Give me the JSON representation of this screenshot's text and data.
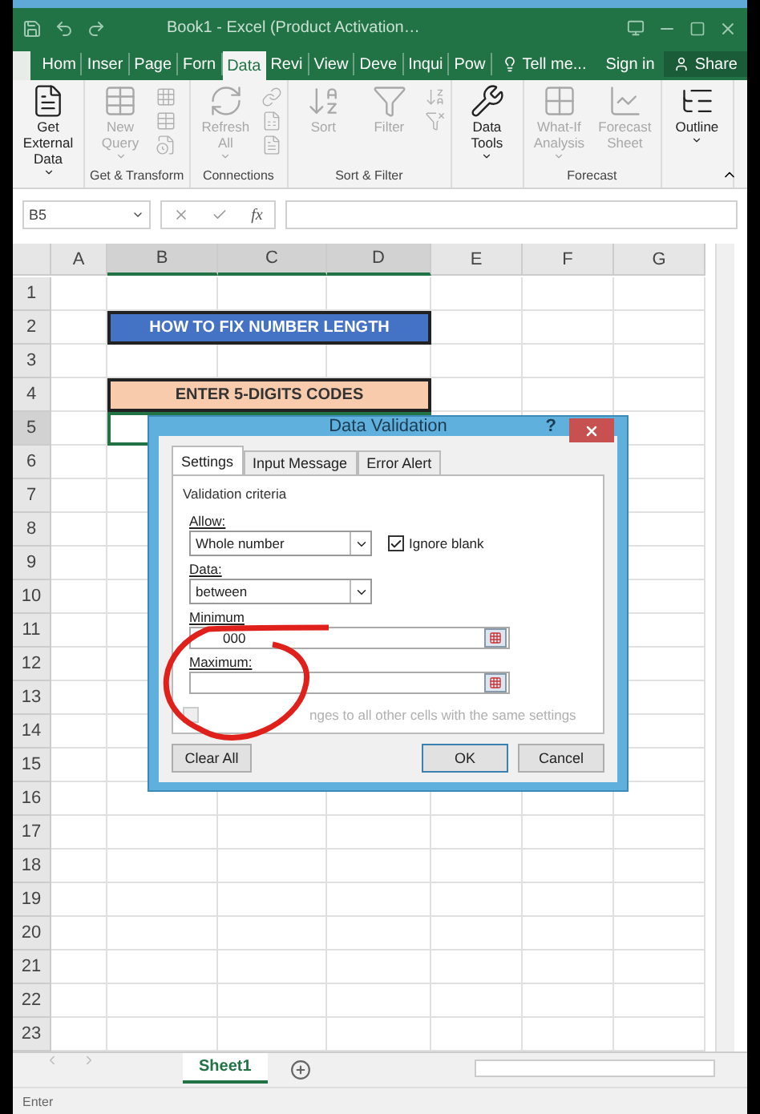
{
  "title_bar": {
    "title": "Book1 - Excel (Product Activation…"
  },
  "ribbon_tabs": [
    {
      "label": "Hom",
      "selected": false
    },
    {
      "label": "Inser",
      "selected": false
    },
    {
      "label": "Page",
      "selected": false
    },
    {
      "label": "Forn",
      "selected": false
    },
    {
      "label": "Data",
      "selected": true
    },
    {
      "label": "Revi",
      "selected": false
    },
    {
      "label": "View",
      "selected": false
    },
    {
      "label": "Deve",
      "selected": false
    },
    {
      "label": "Inqui",
      "selected": false
    },
    {
      "label": "Pow",
      "selected": false
    }
  ],
  "tell_me": "Tell me...",
  "sign_in": "Sign in",
  "share": "Share",
  "ribbon_groups": [
    {
      "commands": [
        {
          "label": "Get External Data",
          "dropdown": true,
          "disabled": false
        }
      ]
    },
    {
      "label": "Get & Transform",
      "commands": [
        {
          "label": "New Query",
          "dropdown": true,
          "disabled": true
        }
      ],
      "small_buttons": [
        {
          "disabled": true
        },
        {
          "disabled": true
        },
        {
          "disabled": true
        }
      ]
    },
    {
      "label": "Connections",
      "commands": [
        {
          "label": "Refresh All",
          "dropdown": true,
          "disabled": true
        }
      ],
      "small_buttons": [
        {
          "disabled": true
        },
        {
          "disabled": true
        },
        {
          "disabled": true
        }
      ]
    },
    {
      "label": "Sort & Filter",
      "commands": [
        {
          "label": "Sort",
          "dropdown": false,
          "disabled": true
        },
        {
          "label": "Filter",
          "dropdown": false,
          "disabled": true
        }
      ],
      "small_buttons": [
        {
          "disabled": true
        },
        {
          "disabled": true
        }
      ]
    },
    {
      "commands": [
        {
          "label": "Data Tools",
          "dropdown": true,
          "disabled": false
        }
      ]
    },
    {
      "label": "Forecast",
      "commands": [
        {
          "label": "What-If Analysis",
          "dropdown": true,
          "disabled": true
        },
        {
          "label": "Forecast Sheet",
          "dropdown": false,
          "disabled": true
        }
      ]
    },
    {
      "commands": [
        {
          "label": "Outline",
          "dropdown": true,
          "disabled": false
        }
      ]
    }
  ],
  "formula_bar": {
    "name_box": "B5",
    "fx": "fx"
  },
  "columns": [
    {
      "label": "A",
      "selected": false
    },
    {
      "label": "B",
      "selected": true
    },
    {
      "label": "C",
      "selected": true
    },
    {
      "label": "D",
      "selected": true
    },
    {
      "label": "E",
      "selected": false
    },
    {
      "label": "F",
      "selected": false
    },
    {
      "label": "G",
      "selected": false
    }
  ],
  "rows": [
    {
      "label": "1",
      "selected": false
    },
    {
      "label": "2",
      "selected": false,
      "merged_cell": {
        "kind": "title",
        "text": "HOW TO FIX NUMBER LENGTH"
      }
    },
    {
      "label": "3",
      "selected": false
    },
    {
      "label": "4",
      "selected": false,
      "merged_cell": {
        "kind": "header",
        "text": "ENTER 5-DIGITS CODES"
      }
    },
    {
      "label": "5",
      "selected": true,
      "merged_cell": {
        "kind": "active"
      }
    },
    {
      "label": "6",
      "selected": false
    },
    {
      "label": "7",
      "selected": false
    },
    {
      "label": "8",
      "selected": false
    },
    {
      "label": "9",
      "selected": false
    },
    {
      "label": "10",
      "selected": false
    },
    {
      "label": "11",
      "selected": false
    },
    {
      "label": "12",
      "selected": false
    },
    {
      "label": "13",
      "selected": false
    },
    {
      "label": "14",
      "selected": false
    },
    {
      "label": "15",
      "selected": false
    },
    {
      "label": "16",
      "selected": false
    },
    {
      "label": "17",
      "selected": false
    },
    {
      "label": "18",
      "selected": false
    },
    {
      "label": "19",
      "selected": false
    },
    {
      "label": "20",
      "selected": false
    },
    {
      "label": "21",
      "selected": false
    },
    {
      "label": "22",
      "selected": false
    },
    {
      "label": "23",
      "selected": false
    }
  ],
  "dialog": {
    "title": "Data Validation",
    "help": "?",
    "tabs": [
      {
        "label": "Settings",
        "selected": true
      },
      {
        "label": "Input Message",
        "selected": false
      },
      {
        "label": "Error Alert",
        "selected": false
      }
    ],
    "section": "Validation criteria",
    "allow": {
      "label": "Allow:",
      "value": "Whole number"
    },
    "ignore_blank": {
      "label": "Ignore blank",
      "checked": true
    },
    "data": {
      "label": "Data:",
      "value": "between"
    },
    "minimum": {
      "label": "Minimum",
      "value": "000"
    },
    "maximum": {
      "label": "Maximum:"
    },
    "apply_all": {
      "label": "nges to all other cells with the same settings",
      "checked": false,
      "disabled": true
    },
    "buttons": [
      {
        "label": "Clear All",
        "kind": "left"
      },
      {
        "label": "OK",
        "kind": "default"
      },
      {
        "label": "Cancel",
        "kind": "normal"
      }
    ]
  },
  "sheet_tabs": [
    {
      "label": "Sheet1",
      "selected": true
    }
  ],
  "status_bar": {
    "mode": "Enter"
  }
}
